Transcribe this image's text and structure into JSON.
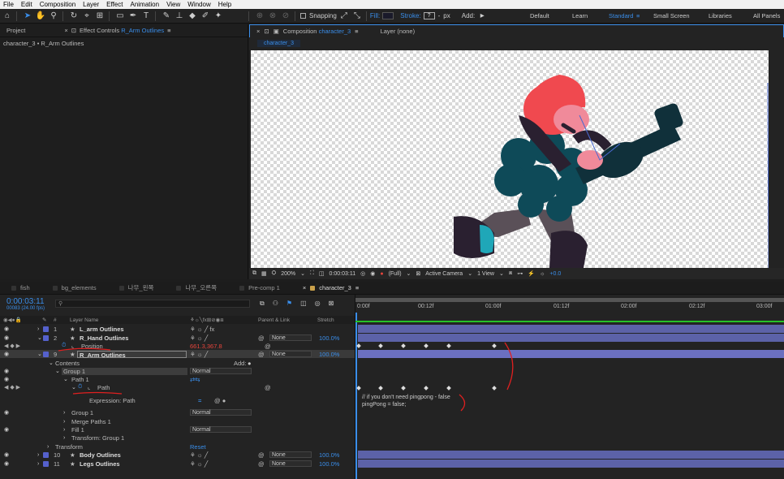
{
  "menu": [
    "File",
    "Edit",
    "Composition",
    "Layer",
    "Effect",
    "Animation",
    "View",
    "Window",
    "Help"
  ],
  "toolbar": {
    "snapping": "Snapping",
    "fill": "Fill:",
    "stroke": "Stroke:",
    "stroke_value": "?",
    "px": "px",
    "add": "Add:",
    "workspaces": [
      "Default",
      "Learn",
      "Standard",
      "Small Screen",
      "Libraries",
      "All Panels"
    ],
    "active_workspace": "Standard"
  },
  "left_panel": {
    "tab_project": "Project",
    "tab_effect_prefix": "Effect Controls",
    "tab_effect_layer": "R_Arm Outlines",
    "subtitle": "character_3 • R_Arm Outlines"
  },
  "comp_panel": {
    "tab_prefix": "Composition",
    "tab_comp": "character_3",
    "tab_layer": "Layer  (none)",
    "subtab": "character_3"
  },
  "viewer": {
    "zoom": "200%",
    "timecode": "0:00:03:11",
    "resolution": "(Full)",
    "camera": "Active Camera",
    "view": "1 View",
    "exposure": "+0.0"
  },
  "timeline_tabs": [
    {
      "label": "fish",
      "color": "#8a8a8a"
    },
    {
      "label": "bg_elements",
      "color": "#8a8a8a"
    },
    {
      "label": "나무_왼쪽",
      "color": "#8a8a8a"
    },
    {
      "label": "나무_오른쪽",
      "color": "#8a8a8a"
    },
    {
      "label": "Pre-comp 1",
      "color": "#8a8a8a"
    },
    {
      "label": "character_3",
      "color": "#c9a04a",
      "active": true
    }
  ],
  "timeline": {
    "timecode": "0:00:03:11",
    "frames": "00083 (24.00 fps)",
    "search_placeholder": "",
    "col_layer_name": "Layer Name",
    "col_parent": "Parent & Link",
    "col_stretch": "Stretch",
    "ruler": [
      "0:00f",
      "00:12f",
      "01:00f",
      "01:12f",
      "02:00f",
      "02:12f",
      "03:00f"
    ],
    "expression_text_1": "// if you don't need pingpong - false",
    "expression_text_2": "pingPong = false;"
  },
  "layers": {
    "l1": {
      "num": "1",
      "name": "L_arm Outlines",
      "parent": "None",
      "stretch": "100.0%"
    },
    "l2": {
      "num": "2",
      "name": "R_Hand Outlines",
      "parent": "None",
      "stretch": "100.0%"
    },
    "position_label": "Position",
    "position_value": "661.3,367.8",
    "l9": {
      "num": "9",
      "name": "R_Arm Outlines",
      "parent": "None",
      "stretch": "100.0%"
    },
    "contents": "Contents",
    "add": "Add:",
    "group1": "Group 1",
    "group1_mode": "Normal",
    "path1": "Path 1",
    "path": "Path",
    "expression_path": "Expression: Path",
    "group1b": "Group 1",
    "group1b_mode": "Normal",
    "merge_paths": "Merge Paths 1",
    "fill1": "Fill 1",
    "fill1_mode": "Normal",
    "transform_group": "Transform: Group 1",
    "transform": "Transform",
    "reset": "Reset",
    "l10": {
      "num": "10",
      "name": "Body Outlines",
      "parent": "None",
      "stretch": "100.0%"
    },
    "l11": {
      "num": "11",
      "name": "Legs Outlines",
      "parent": "None",
      "stretch": "100.0%"
    }
  }
}
